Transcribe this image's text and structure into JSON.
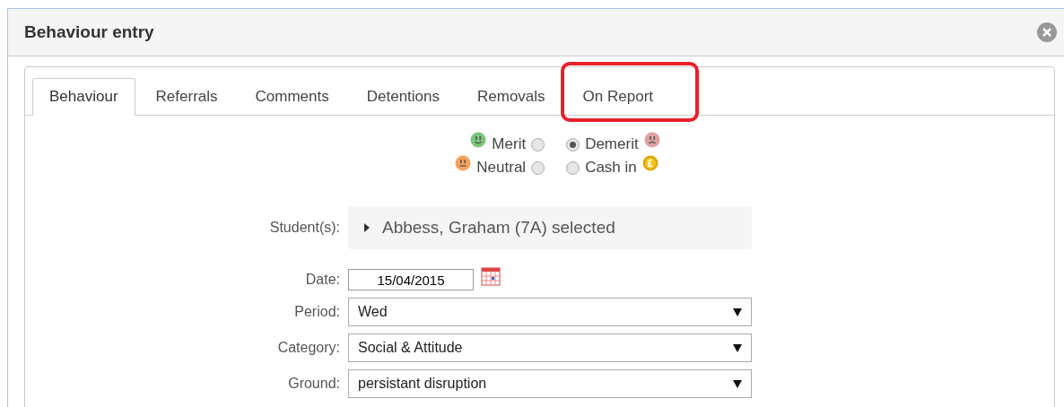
{
  "window": {
    "title": "Behaviour entry"
  },
  "tabs": [
    {
      "label": "Behaviour",
      "selected": true,
      "annotated": false
    },
    {
      "label": "Referrals",
      "selected": false,
      "annotated": false
    },
    {
      "label": "Comments",
      "selected": false,
      "annotated": false
    },
    {
      "label": "Detentions",
      "selected": false,
      "annotated": false
    },
    {
      "label": "Removals",
      "selected": false,
      "annotated": false
    },
    {
      "label": "On Report",
      "selected": false,
      "annotated": true
    }
  ],
  "types": [
    {
      "label": "Merit",
      "kind": "merit",
      "selected": false
    },
    {
      "label": "Demerit",
      "kind": "demerit",
      "selected": true
    },
    {
      "label": "Neutral",
      "kind": "neutral",
      "selected": false
    },
    {
      "label": "Cash in",
      "kind": "cash",
      "selected": false
    }
  ],
  "students": {
    "label": "Student(s):",
    "value": "Abbess, Graham (7A) selected"
  },
  "fields": [
    {
      "label": "Date:",
      "kind": "date",
      "value": "15/04/2015"
    },
    {
      "label": "Period:",
      "kind": "select",
      "value": "Wed"
    },
    {
      "label": "Category:",
      "kind": "select",
      "value": "Social & Attitude"
    },
    {
      "label": "Ground:",
      "kind": "select",
      "value": "persistant disruption"
    }
  ]
}
